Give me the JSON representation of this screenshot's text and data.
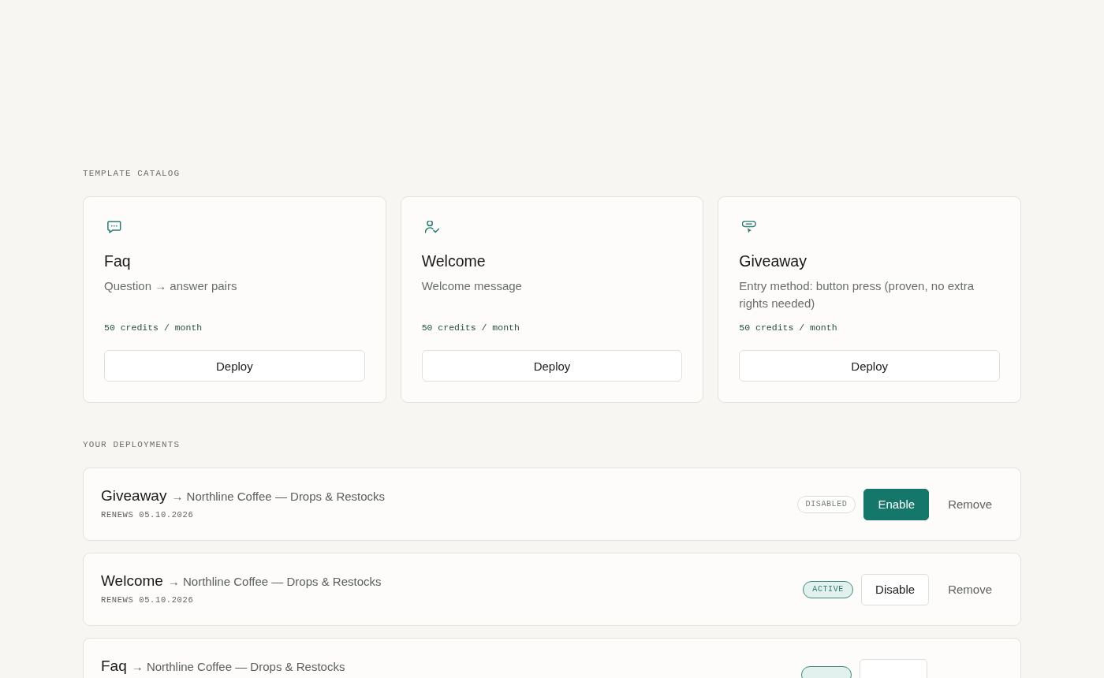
{
  "catalog": {
    "heading": "TEMPLATE CATALOG",
    "templates": [
      {
        "kind": "faq",
        "title": "Faq",
        "description": "Question → answer pairs",
        "price": "50 credits / month",
        "button": "Deploy"
      },
      {
        "kind": "welcome",
        "title": "Welcome",
        "description": "Welcome message",
        "price": "50 credits / month",
        "button": "Deploy"
      },
      {
        "kind": "giveaway",
        "title": "Giveaway",
        "description": "Entry method: button press (proven, no extra rights needed)",
        "price": "50 credits / month",
        "button": "Deploy"
      }
    ]
  },
  "deployments": {
    "heading": "YOUR DEPLOYMENTS",
    "items": [
      {
        "name": "Giveaway",
        "target": "→ Northline Coffee — Drops & Restocks",
        "renews": "RENEWS 05.10.2026",
        "enabled": false,
        "status": "DISABLED",
        "toggle": "Enable",
        "remove": "Remove"
      },
      {
        "name": "Welcome",
        "target": "→ Northline Coffee — Drops & Restocks",
        "renews": "RENEWS 05.10.2026",
        "enabled": true,
        "status": "ACTIVE",
        "toggle": "Disable",
        "remove": "Remove"
      },
      {
        "name": "Faq",
        "target": "→ Northline Coffee — Drops & Restocks",
        "enabled": true
      }
    ]
  }
}
